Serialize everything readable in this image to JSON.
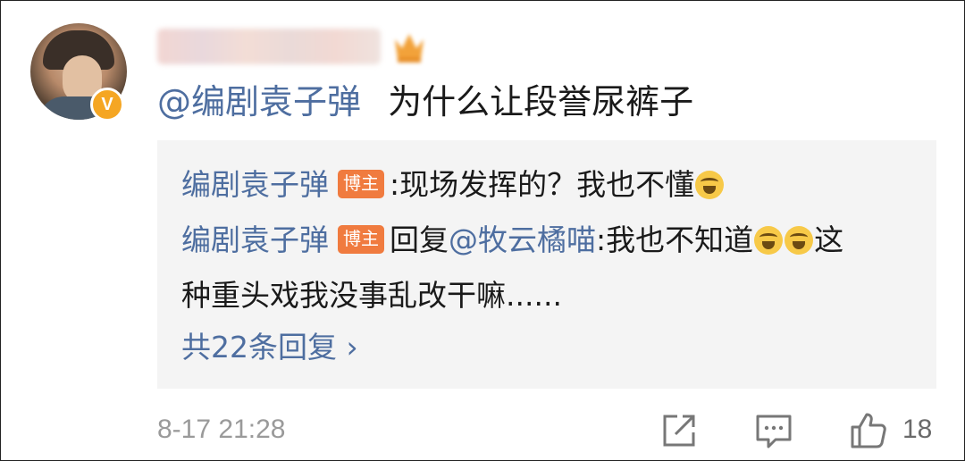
{
  "comment": {
    "mention": "@编剧袁子弹",
    "text": "为什么让段誉尿裤子"
  },
  "replies": [
    {
      "author": "编剧袁子弹",
      "tag": "博主",
      "text": ":现场发挥的？我也不懂"
    },
    {
      "author": "编剧袁子弹",
      "tag": "博主",
      "prefix": "回复",
      "mention": "@牧云橘喵",
      "text": ":我也不知道",
      "text_after": "这",
      "text_line2": "种重头戏我没事乱改干嘛......"
    }
  ],
  "more_replies": "共22条回复 ›",
  "footer": {
    "timestamp": "8-17 21:28",
    "like_count": "18"
  },
  "colors": {
    "link": "#4e6ea0",
    "tag_bg": "#f07b3f",
    "verified_badge": "#f5a623"
  },
  "icons": [
    "share-icon",
    "comment-icon",
    "like-icon",
    "laughing-tears-emoji",
    "verified-v-icon",
    "crown-icon"
  ]
}
